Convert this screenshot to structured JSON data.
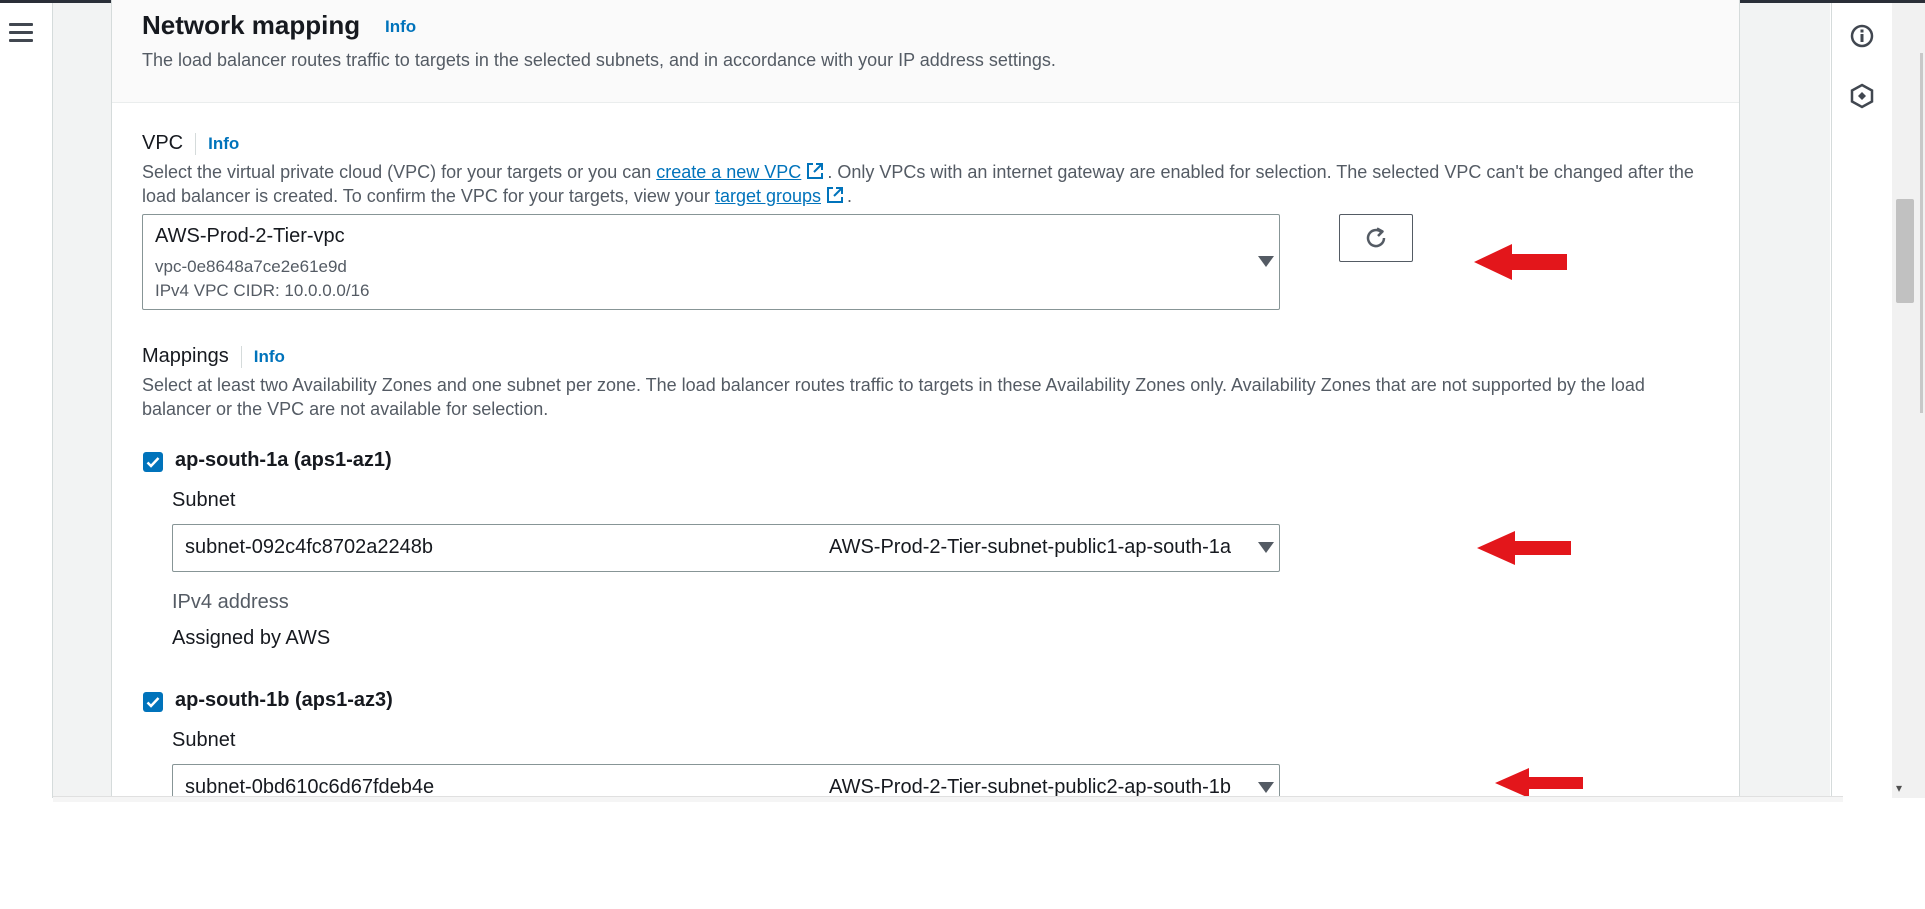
{
  "section": {
    "title": "Network mapping",
    "info": "Info",
    "description": "The load balancer routes traffic to targets in the selected subnets, and in accordance with your IP address settings."
  },
  "vpc": {
    "label": "VPC",
    "info": "Info",
    "desc_part1": "Select the virtual private cloud (VPC) for your targets or you can ",
    "create_link": "create a new VPC",
    "desc_part2": ". Only VPCs with an internet gateway are enabled for selection. The selected VPC can't be changed after the load balancer is created. To confirm the VPC for your targets, view your ",
    "target_groups_link": "target groups",
    "desc_part3": ".",
    "selected_name": "AWS-Prod-2-Tier-vpc",
    "selected_id": "vpc-0e8648a7ce2e61e9d",
    "selected_cidr": "IPv4 VPC CIDR: 10.0.0.0/16"
  },
  "mappings": {
    "label": "Mappings",
    "info": "Info",
    "description": "Select at least two Availability Zones and one subnet per zone. The load balancer routes traffic to targets in these Availability Zones only. Availability Zones that are not supported by the load balancer or the VPC are not available for selection.",
    "zones": [
      {
        "name": "ap-south-1a (aps1-az1)",
        "subnet_label": "Subnet",
        "subnet_id": "subnet-092c4fc8702a2248b",
        "subnet_name": "AWS-Prod-2-Tier-subnet-public1-ap-south-1a",
        "ipv4_label": "IPv4 address",
        "ipv4_value": "Assigned by AWS"
      },
      {
        "name": "ap-south-1b (aps1-az3)",
        "subnet_label": "Subnet",
        "subnet_id": "subnet-0bd610c6d67fdeb4e",
        "subnet_name": "AWS-Prod-2-Tier-subnet-public2-ap-south-1b"
      }
    ]
  },
  "icons": {
    "menu": "hamburger-menu-icon",
    "info": "info-icon",
    "notifications": "hexagon-icon",
    "refresh": "refresh-icon",
    "external": "external-link-icon",
    "annotation": "red-arrow-icon"
  },
  "colors": {
    "link": "#0073bb",
    "checkbox": "#0073bb",
    "annotation_arrow": "#e3161b"
  }
}
